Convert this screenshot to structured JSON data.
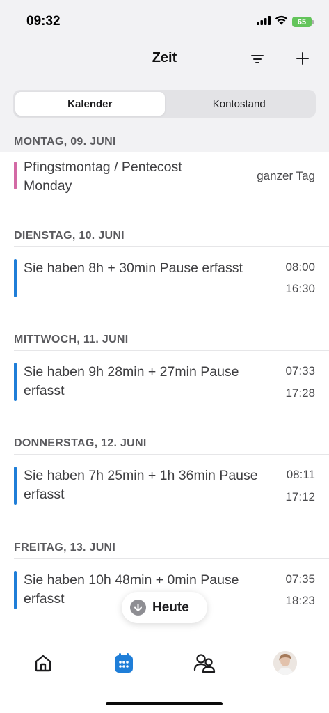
{
  "status_bar": {
    "time": "09:32",
    "battery": "65"
  },
  "header": {
    "title": "Zeit"
  },
  "segmented": {
    "tabs": [
      "Kalender",
      "Kontostand"
    ],
    "selected": "Kalender"
  },
  "days": [
    {
      "label": "MONTAG, 09. JUNI",
      "entry": {
        "text_lines": [
          "Pfingstmontag / Pentecost",
          "Monday"
        ],
        "time_top": "ganzer Tag",
        "time_bottom": "",
        "bar_color": "#d36aa5"
      }
    },
    {
      "label": "DIENSTAG, 10. JUNI",
      "entry": {
        "text_lines": [
          "Sie haben 8h + 30min Pause erfasst",
          ""
        ],
        "time_top": "08:00",
        "time_bottom": "16:30",
        "bar_color": "#1f7ed8"
      }
    },
    {
      "label": "MITTWOCH, 11. JUNI",
      "entry": {
        "text_lines": [
          "Sie haben 9h 28min + 27min Pause",
          "erfasst"
        ],
        "time_top": "07:33",
        "time_bottom": "17:28",
        "bar_color": "#1f7ed8"
      }
    },
    {
      "label": "DONNERSTAG, 12. JUNI",
      "entry": {
        "text_lines": [
          "Sie haben 7h 25min + 1h 36min Pause",
          "erfasst"
        ],
        "time_top": "08:11",
        "time_bottom": "17:12",
        "bar_color": "#1f7ed8"
      }
    },
    {
      "label": "FREITAG, 13. JUNI",
      "entry": {
        "text_lines": [
          "Sie haben 10h 48min + 0min Pause",
          "erfasst"
        ],
        "time_top": "07:35",
        "time_bottom": "18:23",
        "bar_color": "#1f7ed8"
      }
    }
  ],
  "floating_button": {
    "label": "Heute",
    "icon": "arrow-down-circle-icon"
  },
  "tab_bar": {
    "items": [
      {
        "icon": "home-icon",
        "active": false
      },
      {
        "icon": "calendar-icon",
        "active": true
      },
      {
        "icon": "people-icon",
        "active": false
      },
      {
        "icon": "avatar",
        "active": false
      }
    ],
    "accent": "#1f7ed8"
  }
}
